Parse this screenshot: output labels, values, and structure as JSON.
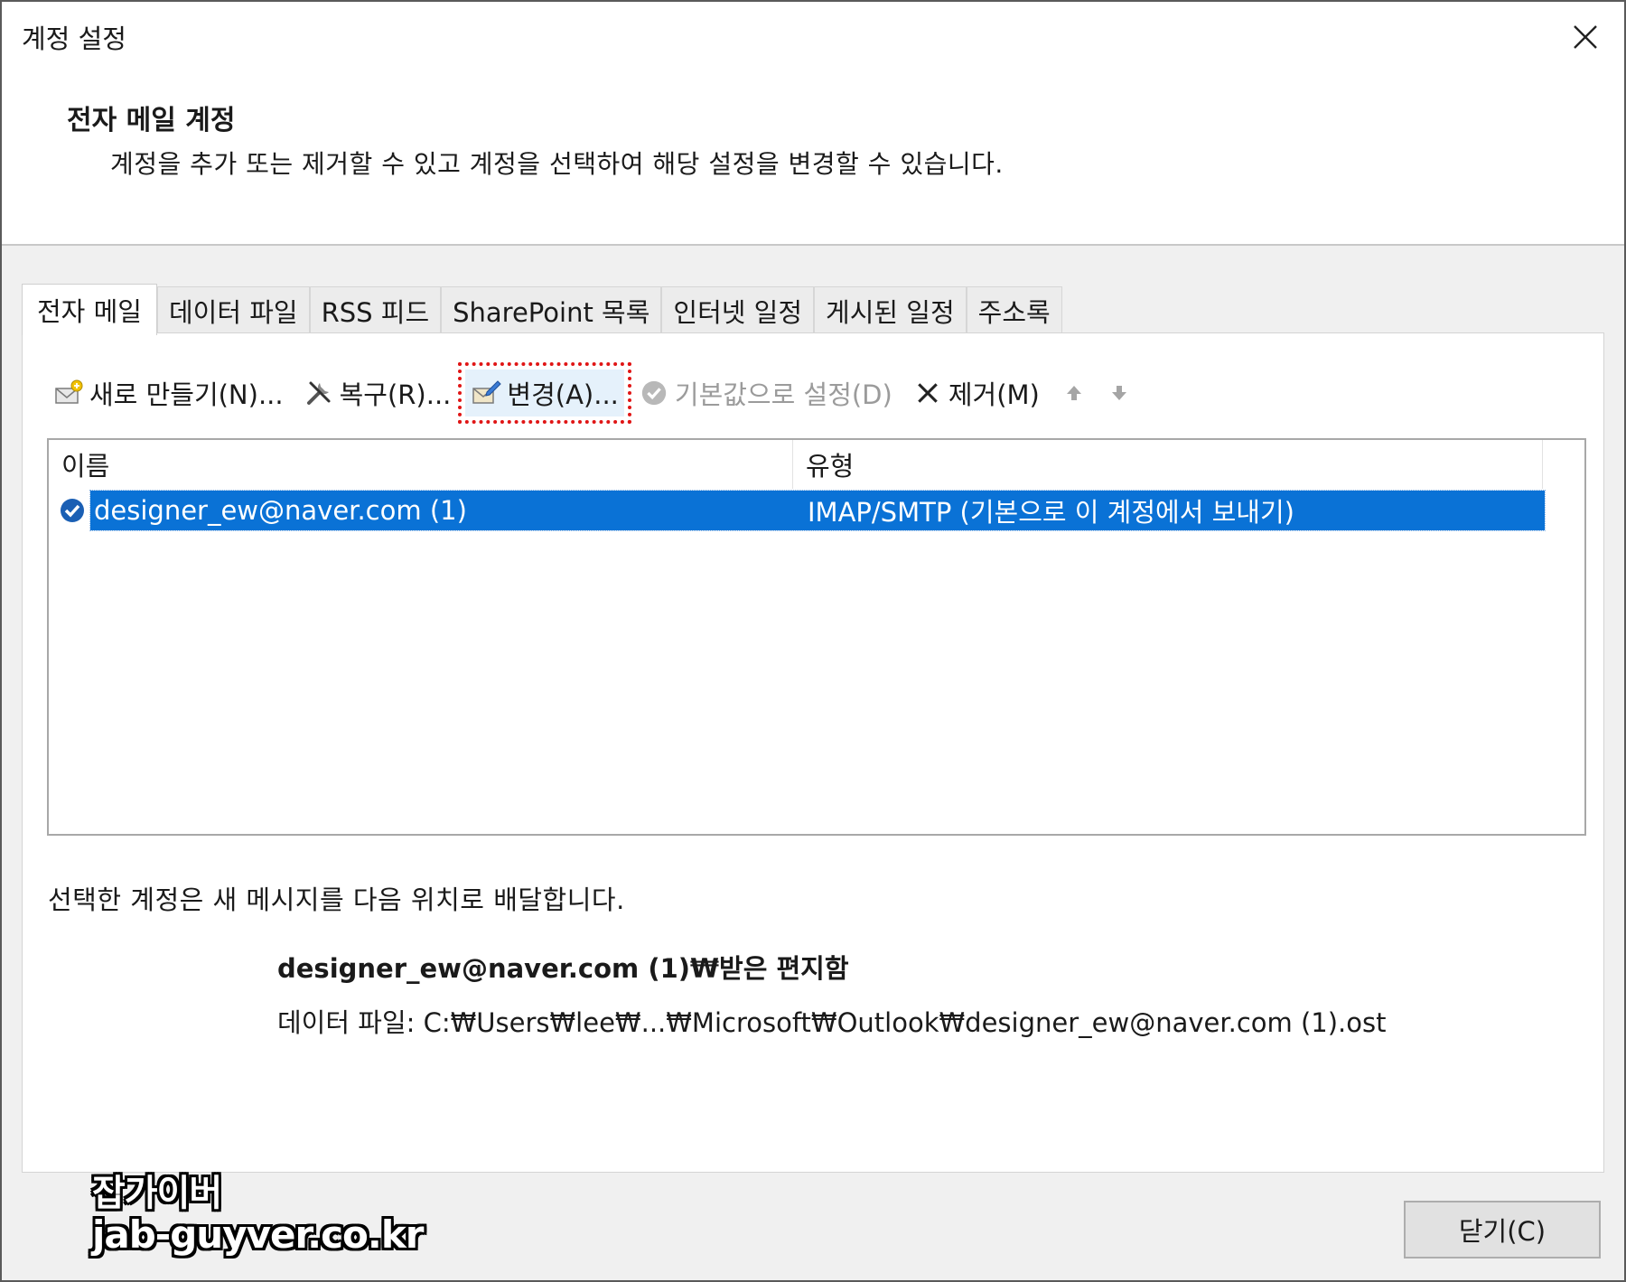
{
  "window": {
    "title": "계정 설정",
    "close_icon": "close-icon"
  },
  "header": {
    "title": "전자 메일 계정",
    "description": "계정을 추가 또는 제거할 수 있고 계정을 선택하여 해당 설정을 변경할 수 있습니다."
  },
  "tabs": [
    {
      "label": "전자 메일",
      "active": true
    },
    {
      "label": "데이터 파일",
      "active": false
    },
    {
      "label": "RSS 피드",
      "active": false
    },
    {
      "label": "SharePoint 목록",
      "active": false
    },
    {
      "label": "인터넷 일정",
      "active": false
    },
    {
      "label": "게시된 일정",
      "active": false
    },
    {
      "label": "주소록",
      "active": false
    }
  ],
  "toolbar": {
    "new_label": "새로 만들기(N)...",
    "repair_label": "복구(R)...",
    "change_label": "변경(A)...",
    "set_default_label": "기본값으로 설정(D)",
    "remove_label": "제거(M)",
    "up_icon": "arrow-up-icon",
    "down_icon": "arrow-down-icon"
  },
  "list": {
    "columns": [
      "이름",
      "유형"
    ],
    "rows": [
      {
        "name": "designer_ew@naver.com (1)",
        "type": "IMAP/SMTP (기본으로 이 계정에서 보내기)",
        "selected": true
      }
    ]
  },
  "delivery": {
    "text": "선택한 계정은 새 메시지를 다음 위치로 배달합니다.",
    "path": "designer_ew@naver.com (1)₩받은 편지함",
    "data_file": "데이터 파일: C:₩Users₩lee₩...₩Microsoft₩Outlook₩designer_ew@naver.com (1).ost"
  },
  "footer": {
    "close_label": "닫기(C)"
  },
  "watermark": {
    "line1": "잡가이버",
    "line2": "jab-guyver.co.kr"
  },
  "colors": {
    "selection": "#0a72d6",
    "highlight_outline": "#e01515",
    "default_check": "#1a5fb4"
  }
}
